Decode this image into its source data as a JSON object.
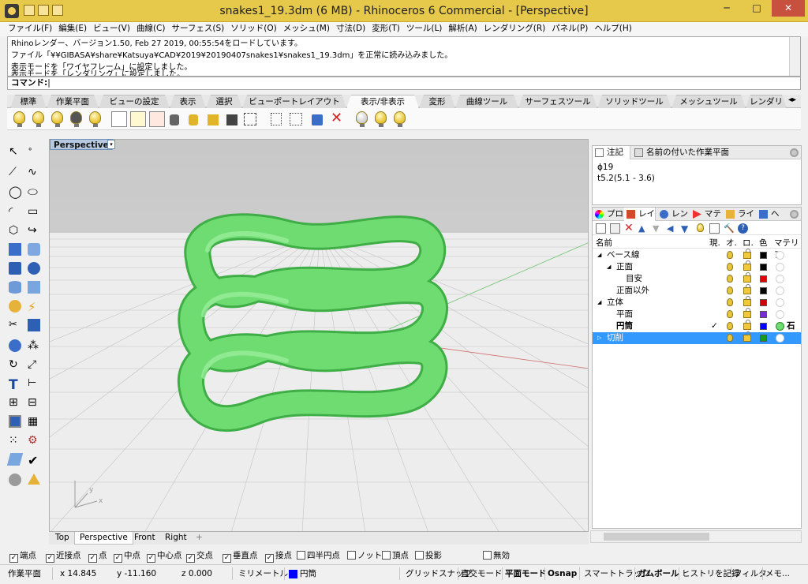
{
  "window": {
    "title": "snakes1_19.3dm (6 MB) - Rhinoceros 6 Commercial - [Perspective]",
    "minimize": "─",
    "maximize": "□",
    "close": "✕"
  },
  "menu": [
    "ファイル(F)",
    "編集(E)",
    "ビュー(V)",
    "曲線(C)",
    "サーフェス(S)",
    "ソリッド(O)",
    "メッシュ(M)",
    "寸法(D)",
    "変形(T)",
    "ツール(L)",
    "解析(A)",
    "レンダリング(R)",
    "パネル(P)",
    "ヘルプ(H)"
  ],
  "history": [
    "Rhinoレンダー、バージョン1.50, Feb 27 2019, 00:55:54をロードしています。",
    "ファイル「¥¥GIBASA¥share¥Katsuya¥CAD¥2019¥20190407snakes1¥snakes1_19.3dm」を正常に読み込みました。",
    "表示モードを「ワイヤフレーム」に設定しました。",
    "表示モードを「レンダリング」に設定しました。"
  ],
  "command_prompt": "コマンド:",
  "toolbar_tabs": [
    "標準",
    "作業平面",
    "ビューの設定",
    "表示",
    "選択",
    "ビューポートレイアウト",
    "表示/非表示",
    "変形",
    "曲線ツール",
    "サーフェスツール",
    "ソリッドツール",
    "メッシュツール",
    "レンダリ"
  ],
  "active_toolbar_tab": "表示/非表示",
  "viewport": {
    "name": "Perspective",
    "dropdown": "▾",
    "axis_x": "x",
    "axis_y": "y",
    "object_color": "#6fdc72"
  },
  "viewport_tabs": [
    "Top",
    "Perspective",
    "Front",
    "Right",
    "+"
  ],
  "notes_panel": {
    "tabs": [
      "注記",
      "名前の付いた作業平面"
    ],
    "lines": [
      "ϕ19",
      "t5.2(5.1 - 3.6)"
    ]
  },
  "layers_panel": {
    "tabs": [
      "プロ",
      "レイ",
      "レン",
      "マテ",
      "ライ",
      "ヘ"
    ],
    "columns": [
      "名前",
      "現.",
      "オ.",
      "ロ.",
      "色",
      "マテリア"
    ],
    "rows": [
      {
        "indent": 0,
        "toggle": "◢",
        "name": "ベース線",
        "current": "",
        "color": "#000000",
        "bold": false,
        "selected": false
      },
      {
        "indent": 1,
        "toggle": "◢",
        "name": "正面",
        "current": "",
        "color": "#000000",
        "bold": false,
        "selected": false
      },
      {
        "indent": 2,
        "toggle": "",
        "name": "目安",
        "current": "",
        "color": "#e00000",
        "bold": false,
        "selected": false
      },
      {
        "indent": 1,
        "toggle": "",
        "name": "正面以外",
        "current": "",
        "color": "#000000",
        "bold": false,
        "selected": false
      },
      {
        "indent": 0,
        "toggle": "◢",
        "name": "立体",
        "current": "",
        "color": "#d00000",
        "bold": false,
        "selected": false
      },
      {
        "indent": 1,
        "toggle": "",
        "name": "平面",
        "current": "",
        "color": "#7a2bd6",
        "bold": false,
        "selected": false
      },
      {
        "indent": 1,
        "toggle": "",
        "name": "円筒",
        "current": "✓",
        "color": "#0000ff",
        "bold": true,
        "selected": false,
        "material": "石こ"
      },
      {
        "indent": 0,
        "toggle": "▷",
        "name": "切削",
        "current": "",
        "color": "#1a9a1a",
        "bold": false,
        "selected": true
      }
    ]
  },
  "osnaps": [
    {
      "label": "端点",
      "checked": true
    },
    {
      "label": "近接点",
      "checked": true
    },
    {
      "label": "点",
      "checked": true
    },
    {
      "label": "中点",
      "checked": true
    },
    {
      "label": "中心点",
      "checked": true
    },
    {
      "label": "交点",
      "checked": true
    },
    {
      "label": "垂直点",
      "checked": true
    },
    {
      "label": "接点",
      "checked": true
    },
    {
      "label": "四半円点",
      "checked": false
    },
    {
      "label": "ノット",
      "checked": false
    },
    {
      "label": "頂点",
      "checked": false
    },
    {
      "label": "投影",
      "checked": false
    },
    {
      "label": "無効",
      "checked": false
    }
  ],
  "status": {
    "cplane": "作業平面",
    "x": "x 14.845",
    "y": "y -11.160",
    "z": "z 0.000",
    "units": "ミリメートル",
    "layer": "円筒",
    "layer_color": "#0000ff",
    "grid_snap": "グリッドスナップ",
    "ortho": "直交モード",
    "planar": "平面モード",
    "osnap": "Osnap",
    "smarttrack": "スマートトラック",
    "gumball": "ガムボール",
    "history": "ヒストリを記録",
    "filter": "フィルタ",
    "memory": "メモ..."
  }
}
